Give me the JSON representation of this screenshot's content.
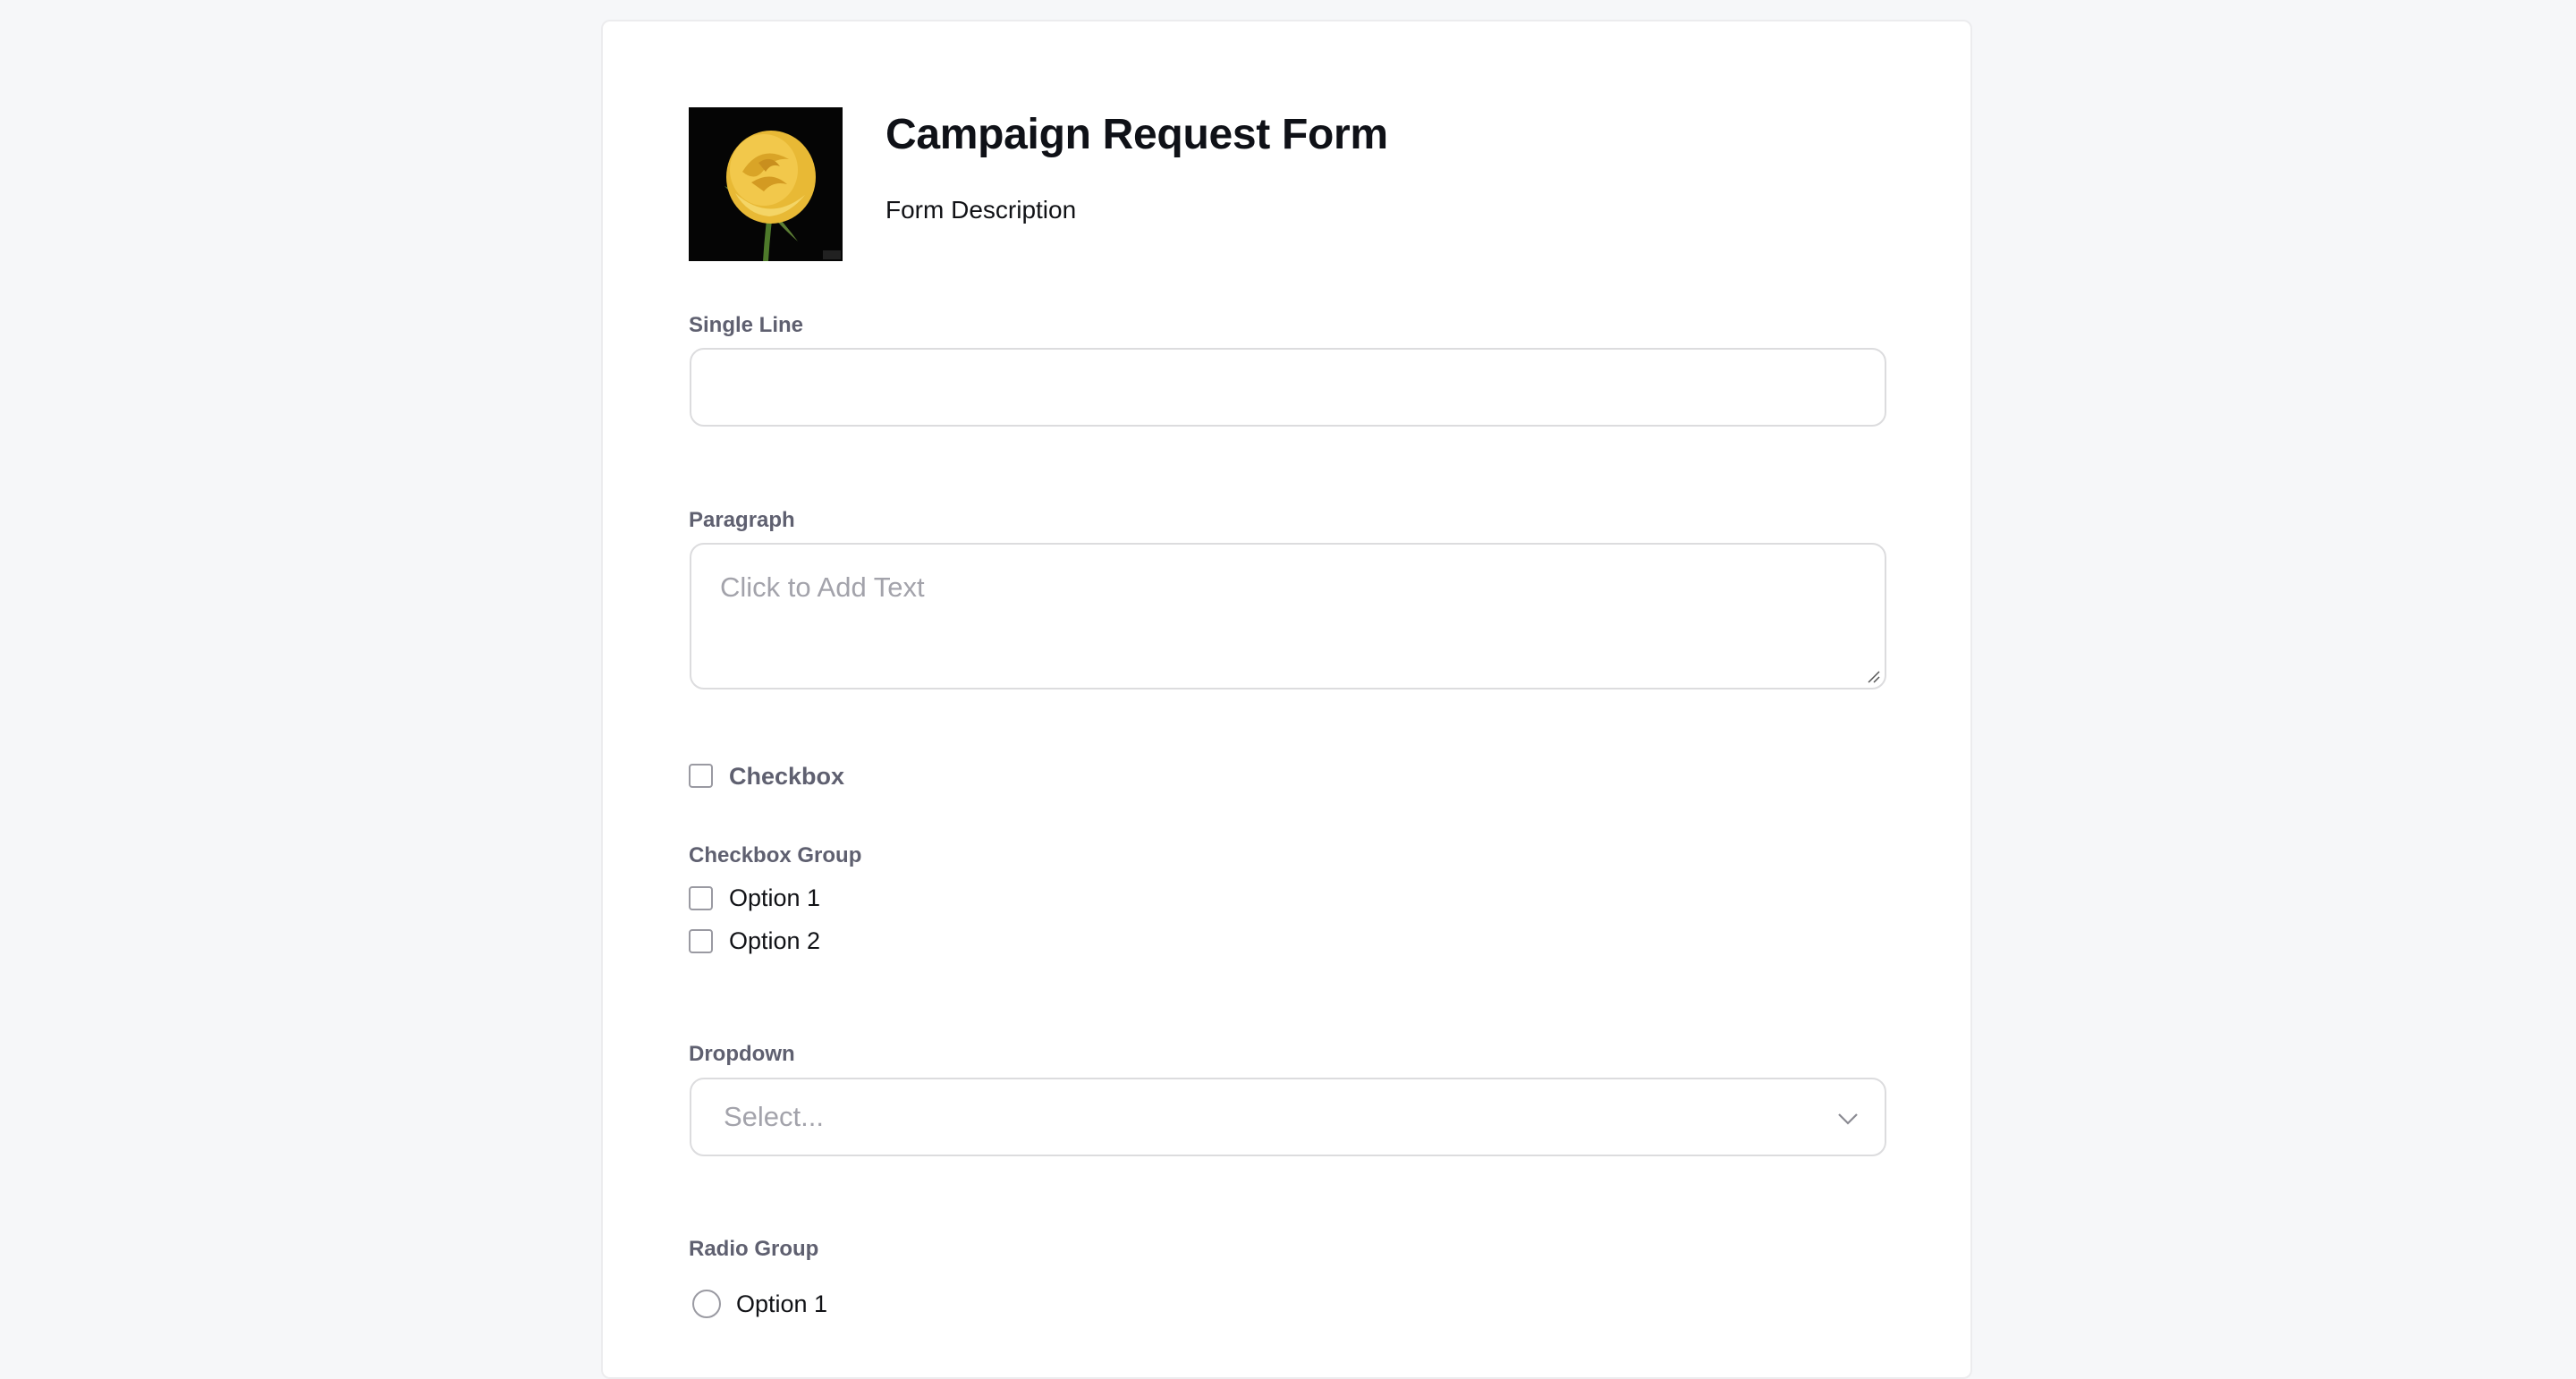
{
  "form": {
    "title": "Campaign Request Form",
    "description": "Form Description",
    "logo": "yellow-rose-image"
  },
  "fields": {
    "single_line": {
      "label": "Single Line",
      "value": ""
    },
    "paragraph": {
      "label": "Paragraph",
      "placeholder": "Click to Add Text",
      "value": ""
    },
    "checkbox": {
      "label": "Checkbox",
      "checked": false
    },
    "checkbox_group": {
      "label": "Checkbox Group",
      "options": [
        {
          "label": "Option 1",
          "checked": false
        },
        {
          "label": "Option 2",
          "checked": false
        }
      ]
    },
    "dropdown": {
      "label": "Dropdown",
      "placeholder": "Select...",
      "icon": "chevron-down-icon"
    },
    "radio_group": {
      "label": "Radio Group",
      "options": [
        {
          "label": "Option 1",
          "selected": false
        }
      ]
    }
  },
  "colors": {
    "background": "#f6f7f9",
    "card": "#ffffff",
    "label": "#5f6070",
    "placeholder": "#a3a3ab",
    "border": "#dcdcde"
  }
}
